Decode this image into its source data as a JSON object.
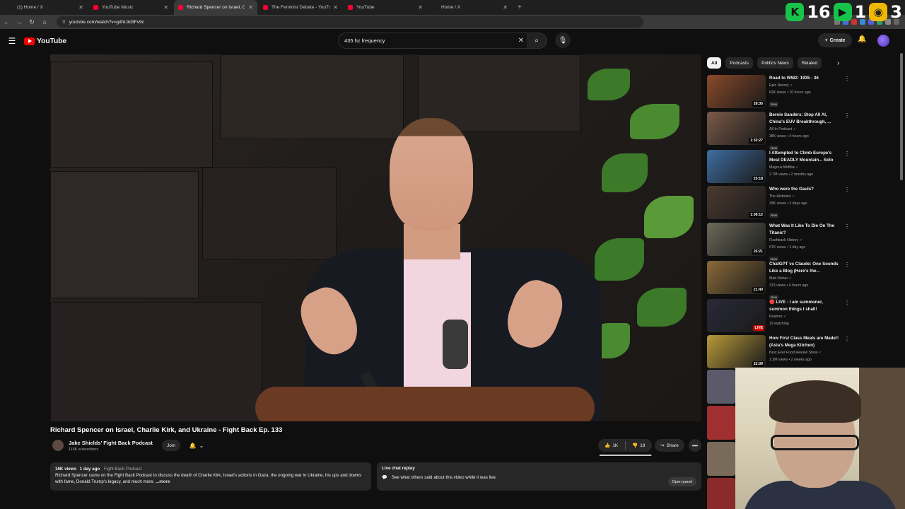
{
  "browser": {
    "tabs": [
      {
        "label": "(1) Home / X",
        "color": "#1d1d1d",
        "active": false
      },
      {
        "label": "YouTube Music",
        "color": "#ff0033",
        "active": false
      },
      {
        "label": "Richard Spencer on Israel, C",
        "color": "#ff0033",
        "active": true
      },
      {
        "label": "The Feminist Debate - YouTube",
        "color": "#ff0033",
        "active": false
      },
      {
        "label": "YouTube",
        "color": "#ff0033",
        "active": false
      },
      {
        "label": "Home / X",
        "color": "#1d1d1d",
        "active": false
      }
    ],
    "url": "youtube.com/watch?v=gdhL9d3Fv9c"
  },
  "counters": [
    {
      "value": "16",
      "color": "#19c24a",
      "icon": "k-icon",
      "glyph": "K"
    },
    {
      "value": "1",
      "color": "#19c24a",
      "icon": "play-icon",
      "glyph": "▶"
    },
    {
      "value": "3",
      "color": "#f0b800",
      "icon": "gamepad-icon",
      "glyph": "◉"
    }
  ],
  "header": {
    "logo": "YouTube",
    "search_value": "435 hz frequency",
    "create_label": "Create"
  },
  "video": {
    "title": "Richard Spencer on Israel, Charlie Kirk, and Ukraine - Fight Back Ep. 133",
    "channel": "Jake Shields' Fight Back Podcast",
    "subscribers": "116K subscribers",
    "join_label": "Join",
    "likes": "1K",
    "like_fraction": 0.98,
    "dislikes": "18",
    "share_label": "Share",
    "views": "16K views",
    "date": "1 day ago",
    "tags": "Fight Back Podcast",
    "description": "Richard Spencer came on the Fight Back Podcast to discuss the death of Charlie Kirk, Israel's actions in Gaza, the ongoing war in Ukraine, his ups and downs with fame, Donald Trump's legacy, and much more.",
    "more_label": "...more"
  },
  "live_chat": {
    "title": "Live chat replay",
    "text": "See what others said about this video while it was live.",
    "button": "Open panel"
  },
  "chips": [
    "All",
    "Podcasts",
    "Politics News",
    "Related"
  ],
  "sidebar": [
    {
      "title": "Road to WW2: 1935 - 36",
      "channel": "Epic History",
      "meta": "62K views • 10 hours ago",
      "new": "New",
      "duration": "28:35",
      "thumb": "#8a4a2a"
    },
    {
      "title": "Bernie Sanders: Stop All AI, China's EUV Breakthrough, ...",
      "channel": "All-In Podcast",
      "meta": "38K views • 4 hours ago",
      "new": "New",
      "duration": "1:30:27",
      "thumb": "#7a5a48"
    },
    {
      "title": "I Attempted to Climb Europe's Most DEADLY Mountain... Solo",
      "channel": "Magnus Midtbø",
      "meta": "2.7M views • 2 months ago",
      "new": "",
      "duration": "25:18",
      "thumb": "#3f6da0"
    },
    {
      "title": "Who were the Gauls?",
      "channel": "The Histories",
      "meta": "28K views • 2 days ago",
      "new": "New",
      "duration": "1:08:12",
      "thumb": "#4a3a30"
    },
    {
      "title": "What Was It Like To Die On The Titanic?",
      "channel": "Flashback History",
      "meta": "67K views • 1 day ago",
      "new": "New",
      "duration": "26:21",
      "thumb": "#6a6a5a"
    },
    {
      "title": "ChatGPT vs Claude: One Sounds Like a Blog (Here's the...",
      "channel": "Matt Maher",
      "meta": "313 views • 4 hours ago",
      "new": "New",
      "duration": "21:40",
      "thumb": "#8a6a3a"
    },
    {
      "title": "🔴 LIVE - I am summoner, summon things I shall!",
      "channel": "Roamor",
      "meta": "19 watching",
      "new": "",
      "duration": "LIVE",
      "thumb": "#2a2a3a"
    },
    {
      "title": "How First Class Meals are Made!! (Asia's Mega Kitchen)",
      "channel": "Best Ever Food Review Show",
      "meta": "1.3M views • 2 weeks ago",
      "new": "",
      "duration": "22:09",
      "thumb": "#b89a3a"
    }
  ]
}
